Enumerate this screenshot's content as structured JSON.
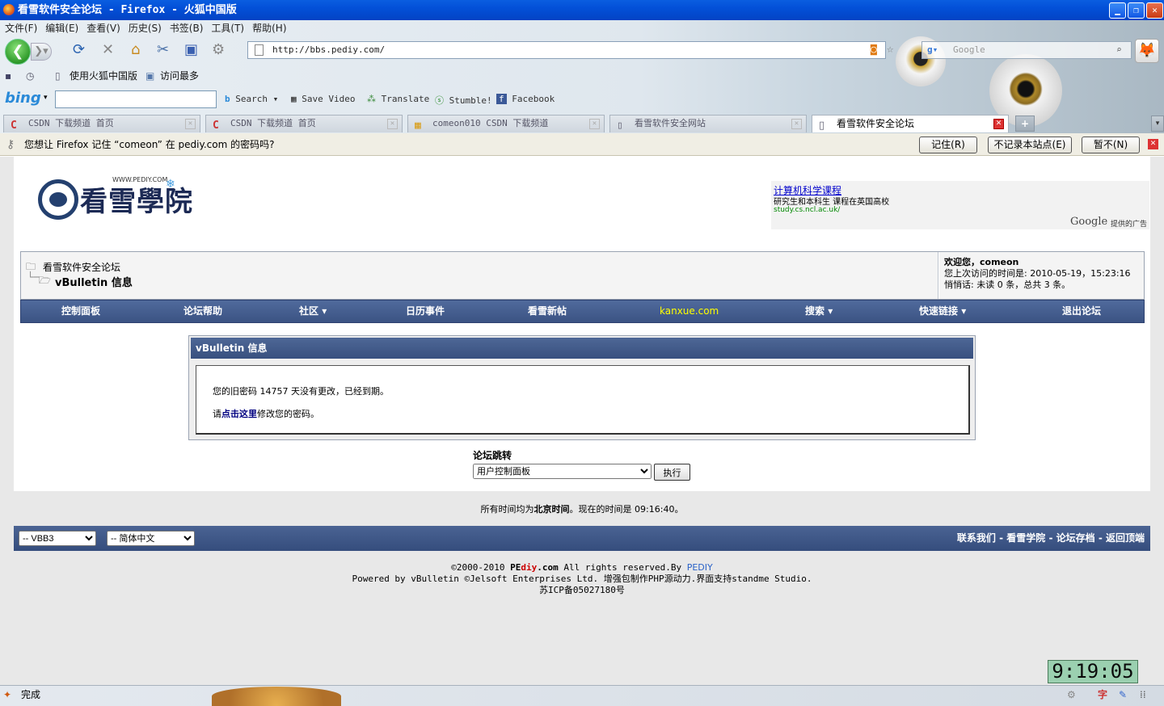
{
  "window": {
    "title": "看雪软件安全论坛 - Firefox - 火狐中国版"
  },
  "menu": [
    "文件(F)",
    "编辑(E)",
    "查看(V)",
    "历史(S)",
    "书签(B)",
    "工具(T)",
    "帮助(H)"
  ],
  "address": {
    "url": "http://bbs.pediy.com/"
  },
  "search": {
    "placeholder": "Google"
  },
  "bookmarks": [
    "使用火狐中国版",
    "访问最多"
  ],
  "toolbar": {
    "brand": "bing",
    "items": [
      "Search",
      "Save Video",
      "Translate",
      "Stumble!",
      "Facebook"
    ]
  },
  "tabs": [
    {
      "label": "CSDN 下载频道 首页",
      "active": false
    },
    {
      "label": "CSDN 下载频道 首页",
      "active": false
    },
    {
      "label": "comeon010 CSDN 下载频道",
      "active": false
    },
    {
      "label": "看雪软件安全网站",
      "active": false
    },
    {
      "label": "看雪软件安全论坛",
      "active": true
    }
  ],
  "notification": {
    "text": "您想让 Firefox 记住 “comeon” 在 pediy.com 的密码吗?",
    "remember": "记住(R)",
    "never": "不记录本站点(E)",
    "notnow": "暂不(N)"
  },
  "logo": {
    "text": "看雪學院",
    "url": "WWW.PEDIY.COM"
  },
  "ad": {
    "title": "计算机科学课程",
    "desc": "研究生和本科生 课程在英国高校",
    "link": "study.cs.ncl.ac.uk/",
    "google": "Google",
    "provided": "提供的广告"
  },
  "breadcrumb": {
    "root": "看雪软件安全论坛",
    "current": "vBulletin 信息"
  },
  "welcome": {
    "greeting": "欢迎您，comeon",
    "last_visit": "您上次访问的时间是: 2010-05-19，15:23:16",
    "messages": "悄悄话: 未读 0 条，总共 3 条。"
  },
  "nav": [
    "控制面板",
    "论坛帮助",
    "社区",
    "日历事件",
    "看雪新帖",
    "kanxue.com",
    "搜索",
    "快速链接",
    "退出论坛"
  ],
  "message": {
    "header": "vBulletin 信息",
    "line1": "您的旧密码 14757 天没有更改，已经到期。",
    "line2_prefix": "请",
    "line2_link": "点击这里",
    "line2_suffix": "修改您的密码。"
  },
  "jump": {
    "label": "论坛跳转",
    "selected": "用户控制面板",
    "go": "执行"
  },
  "time_note": {
    "prefix": "所有时间均为",
    "zone": "北京时间",
    "middle": "。现在的时间是 ",
    "time": "09:16:40",
    "suffix": "。"
  },
  "footer": {
    "style": "-- VBB3",
    "language": "-- 简体中文",
    "links": [
      "联系我们",
      "看雪学院",
      "论坛存档",
      "返回顶端"
    ]
  },
  "copyright": {
    "prefix": "©2000-2010 ",
    "pe": "PE",
    "diy": "diy",
    "dotcom": ".com",
    "rights": " All rights reserved.By ",
    "pediy": "PEDIY",
    "line2": "Powered by vBulletin ©Jelsoft Enterprises Ltd. 增强包制作PHP源动力.界面支持standme Studio.",
    "line3": "苏ICP备05027180号"
  },
  "clock": "9:19:05",
  "status": {
    "text": "完成"
  },
  "colors": {
    "titlebar": "#0350d8",
    "nav": "#3b5383",
    "accent_link": "#000080",
    "kanxue": "#ffff00"
  }
}
